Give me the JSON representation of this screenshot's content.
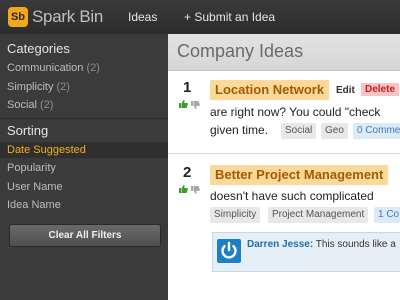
{
  "app": {
    "logo_letters": "Sb",
    "name": "Spark Bin",
    "nav": [
      "Ideas",
      "+ Submit an Idea"
    ]
  },
  "sidebar": {
    "categories_title": "Categories",
    "categories": [
      {
        "label": "Communication",
        "count": "(2)"
      },
      {
        "label": "Simplicity",
        "count": "(2)"
      },
      {
        "label": "Social",
        "count": "(2)"
      }
    ],
    "sorting_title": "Sorting",
    "sorting": [
      "Date Suggested",
      "Popularity",
      "User Name",
      "Idea Name"
    ],
    "active_sort": "Date Suggested",
    "clear_button": "Clear All Filters"
  },
  "main": {
    "title": "Company Ideas",
    "ideas": [
      {
        "rank": "1",
        "title": "Location Network",
        "edit": "Edit",
        "delete": "Delete",
        "description": "are right now? You could \"check",
        "description2": "given time.",
        "tags": [
          "Social",
          "Geo"
        ],
        "comments": "0 Comme"
      },
      {
        "rank": "2",
        "title": "Better Project Management",
        "description": "doesn't have such complicated",
        "tags": [
          "Simplicity",
          "Project Management"
        ],
        "comments": "1 Co",
        "comment_author": "Darren Jesse:",
        "comment_text": "This sounds like a"
      }
    ]
  },
  "colors": {
    "accent": "#f2b01a",
    "title_highlight": "#fbd99a",
    "link_blue": "#3a7bc8"
  }
}
